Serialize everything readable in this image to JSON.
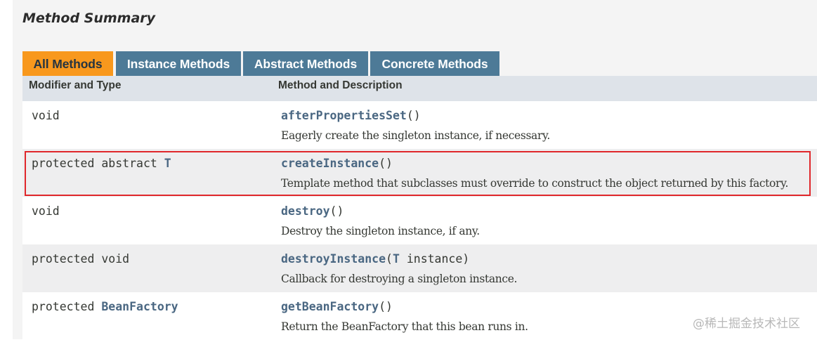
{
  "section": {
    "title": "Method Summary"
  },
  "tabs": [
    {
      "label": "All Methods",
      "active": true
    },
    {
      "label": "Instance Methods",
      "active": false
    },
    {
      "label": "Abstract Methods",
      "active": false
    },
    {
      "label": "Concrete Methods",
      "active": false
    }
  ],
  "table": {
    "headers": {
      "modifier": "Modifier and Type",
      "method": "Method and Description"
    },
    "rows": [
      {
        "modifier_prefix": "void",
        "modifier_type": "",
        "method_name": "afterPropertiesSet",
        "params_open": "(",
        "param_type": "",
        "param_name": "",
        "params_close": ")",
        "description": "Eagerly create the singleton instance, if necessary."
      },
      {
        "modifier_prefix": "protected abstract ",
        "modifier_type": "T",
        "method_name": "createInstance",
        "params_open": "(",
        "param_type": "",
        "param_name": "",
        "params_close": ")",
        "description": "Template method that subclasses must override to construct the object returned by this factory.",
        "highlighted": true
      },
      {
        "modifier_prefix": "void",
        "modifier_type": "",
        "method_name": "destroy",
        "params_open": "(",
        "param_type": "",
        "param_name": "",
        "params_close": ")",
        "description": "Destroy the singleton instance, if any."
      },
      {
        "modifier_prefix": "protected void",
        "modifier_type": "",
        "method_name": "destroyInstance",
        "params_open": "(",
        "param_type": "T",
        "param_name": " instance",
        "params_close": ")",
        "description": "Callback for destroying a singleton instance."
      },
      {
        "modifier_prefix": "protected ",
        "modifier_type": "BeanFactory",
        "method_name": "getBeanFactory",
        "params_open": "(",
        "param_type": "",
        "param_name": "",
        "params_close": ")",
        "description": "Return the BeanFactory that this bean runs in."
      }
    ]
  },
  "watermark": "@稀土掘金技术社区",
  "colors": {
    "active_tab": "#f8981d",
    "inactive_tab": "#4d7a97",
    "header_bg": "#dee3e9",
    "link": "#4a6782",
    "highlight_border": "#e0272b"
  }
}
